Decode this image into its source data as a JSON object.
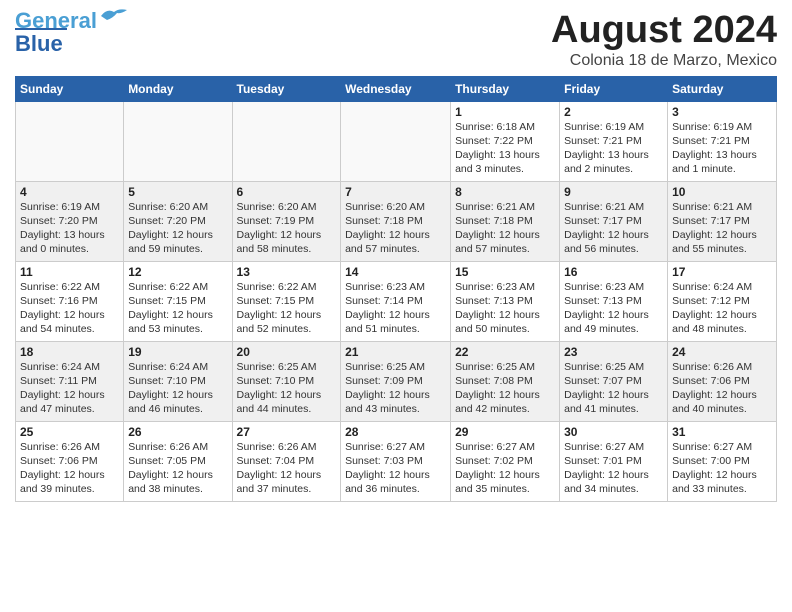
{
  "header": {
    "logo_line1": "General",
    "logo_line2": "Blue",
    "month": "August 2024",
    "location": "Colonia 18 de Marzo, Mexico"
  },
  "weekdays": [
    "Sunday",
    "Monday",
    "Tuesday",
    "Wednesday",
    "Thursday",
    "Friday",
    "Saturday"
  ],
  "weeks": [
    [
      {
        "day": "",
        "info": ""
      },
      {
        "day": "",
        "info": ""
      },
      {
        "day": "",
        "info": ""
      },
      {
        "day": "",
        "info": ""
      },
      {
        "day": "1",
        "info": "Sunrise: 6:18 AM\nSunset: 7:22 PM\nDaylight: 13 hours\nand 3 minutes."
      },
      {
        "day": "2",
        "info": "Sunrise: 6:19 AM\nSunset: 7:21 PM\nDaylight: 13 hours\nand 2 minutes."
      },
      {
        "day": "3",
        "info": "Sunrise: 6:19 AM\nSunset: 7:21 PM\nDaylight: 13 hours\nand 1 minute."
      }
    ],
    [
      {
        "day": "4",
        "info": "Sunrise: 6:19 AM\nSunset: 7:20 PM\nDaylight: 13 hours\nand 0 minutes."
      },
      {
        "day": "5",
        "info": "Sunrise: 6:20 AM\nSunset: 7:20 PM\nDaylight: 12 hours\nand 59 minutes."
      },
      {
        "day": "6",
        "info": "Sunrise: 6:20 AM\nSunset: 7:19 PM\nDaylight: 12 hours\nand 58 minutes."
      },
      {
        "day": "7",
        "info": "Sunrise: 6:20 AM\nSunset: 7:18 PM\nDaylight: 12 hours\nand 57 minutes."
      },
      {
        "day": "8",
        "info": "Sunrise: 6:21 AM\nSunset: 7:18 PM\nDaylight: 12 hours\nand 57 minutes."
      },
      {
        "day": "9",
        "info": "Sunrise: 6:21 AM\nSunset: 7:17 PM\nDaylight: 12 hours\nand 56 minutes."
      },
      {
        "day": "10",
        "info": "Sunrise: 6:21 AM\nSunset: 7:17 PM\nDaylight: 12 hours\nand 55 minutes."
      }
    ],
    [
      {
        "day": "11",
        "info": "Sunrise: 6:22 AM\nSunset: 7:16 PM\nDaylight: 12 hours\nand 54 minutes."
      },
      {
        "day": "12",
        "info": "Sunrise: 6:22 AM\nSunset: 7:15 PM\nDaylight: 12 hours\nand 53 minutes."
      },
      {
        "day": "13",
        "info": "Sunrise: 6:22 AM\nSunset: 7:15 PM\nDaylight: 12 hours\nand 52 minutes."
      },
      {
        "day": "14",
        "info": "Sunrise: 6:23 AM\nSunset: 7:14 PM\nDaylight: 12 hours\nand 51 minutes."
      },
      {
        "day": "15",
        "info": "Sunrise: 6:23 AM\nSunset: 7:13 PM\nDaylight: 12 hours\nand 50 minutes."
      },
      {
        "day": "16",
        "info": "Sunrise: 6:23 AM\nSunset: 7:13 PM\nDaylight: 12 hours\nand 49 minutes."
      },
      {
        "day": "17",
        "info": "Sunrise: 6:24 AM\nSunset: 7:12 PM\nDaylight: 12 hours\nand 48 minutes."
      }
    ],
    [
      {
        "day": "18",
        "info": "Sunrise: 6:24 AM\nSunset: 7:11 PM\nDaylight: 12 hours\nand 47 minutes."
      },
      {
        "day": "19",
        "info": "Sunrise: 6:24 AM\nSunset: 7:10 PM\nDaylight: 12 hours\nand 46 minutes."
      },
      {
        "day": "20",
        "info": "Sunrise: 6:25 AM\nSunset: 7:10 PM\nDaylight: 12 hours\nand 44 minutes."
      },
      {
        "day": "21",
        "info": "Sunrise: 6:25 AM\nSunset: 7:09 PM\nDaylight: 12 hours\nand 43 minutes."
      },
      {
        "day": "22",
        "info": "Sunrise: 6:25 AM\nSunset: 7:08 PM\nDaylight: 12 hours\nand 42 minutes."
      },
      {
        "day": "23",
        "info": "Sunrise: 6:25 AM\nSunset: 7:07 PM\nDaylight: 12 hours\nand 41 minutes."
      },
      {
        "day": "24",
        "info": "Sunrise: 6:26 AM\nSunset: 7:06 PM\nDaylight: 12 hours\nand 40 minutes."
      }
    ],
    [
      {
        "day": "25",
        "info": "Sunrise: 6:26 AM\nSunset: 7:06 PM\nDaylight: 12 hours\nand 39 minutes."
      },
      {
        "day": "26",
        "info": "Sunrise: 6:26 AM\nSunset: 7:05 PM\nDaylight: 12 hours\nand 38 minutes."
      },
      {
        "day": "27",
        "info": "Sunrise: 6:26 AM\nSunset: 7:04 PM\nDaylight: 12 hours\nand 37 minutes."
      },
      {
        "day": "28",
        "info": "Sunrise: 6:27 AM\nSunset: 7:03 PM\nDaylight: 12 hours\nand 36 minutes."
      },
      {
        "day": "29",
        "info": "Sunrise: 6:27 AM\nSunset: 7:02 PM\nDaylight: 12 hours\nand 35 minutes."
      },
      {
        "day": "30",
        "info": "Sunrise: 6:27 AM\nSunset: 7:01 PM\nDaylight: 12 hours\nand 34 minutes."
      },
      {
        "day": "31",
        "info": "Sunrise: 6:27 AM\nSunset: 7:00 PM\nDaylight: 12 hours\nand 33 minutes."
      }
    ]
  ]
}
